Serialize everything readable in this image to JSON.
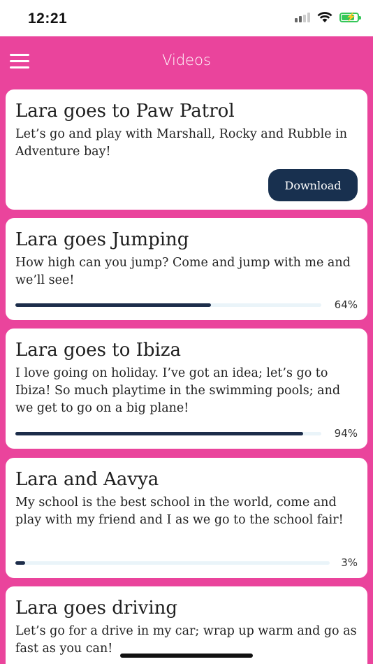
{
  "status": {
    "time": "12:21"
  },
  "header": {
    "title": "Videos"
  },
  "videos": [
    {
      "title": "Lara goes to Paw Patrol",
      "description": "Let’s go and play with Marshall, Rocky and Rubble in Adventure bay!",
      "action": "Download"
    },
    {
      "title": "Lara goes Jumping",
      "description": "How high can you jump? Come and jump with me and we’ll see!",
      "progress": 0.64,
      "progress_label": "64%"
    },
    {
      "title": "Lara goes to Ibiza",
      "description": "I love going on holiday. I’ve got an idea; let’s go to Ibiza! So much playtime in the swimming pools; and we get to go on a big plane!",
      "progress": 0.94,
      "progress_label": "94%"
    },
    {
      "title": "Lara and Aavya",
      "description": "My school is the best school in the world, come and play with my friend and I as we go to the school fair!",
      "progress": 0.03,
      "progress_label": "3%"
    },
    {
      "title": "Lara goes driving",
      "description": "Let’s go for a drive in my car; wrap up warm and go as fast as you can!"
    }
  ],
  "colors": {
    "header_bg": "#ea449c",
    "button_bg": "#18304f",
    "progress": "#1c2d4a"
  }
}
